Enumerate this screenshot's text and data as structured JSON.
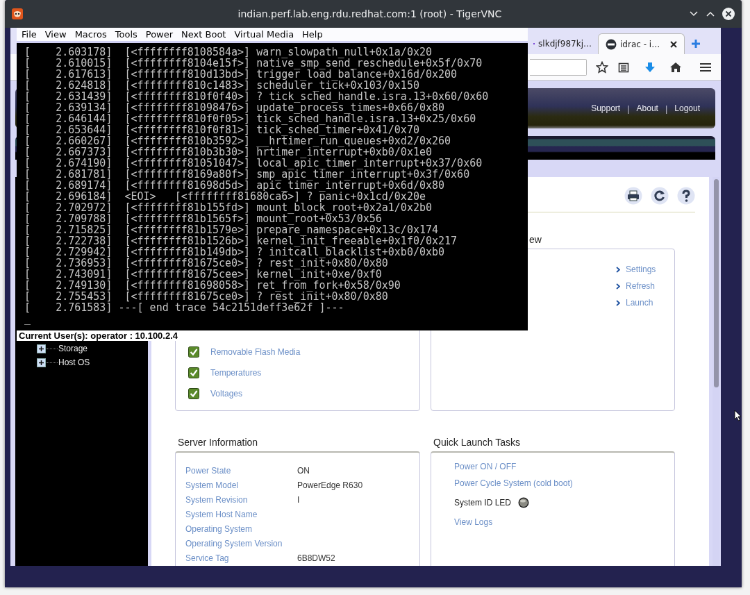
{
  "vnc_window": {
    "title": "indian.perf.lab.eng.rdu.redhat.com:1 (root) - TigerVNC"
  },
  "browser": {
    "tabs": [
      {
        "label": "slkdjf987kj…",
        "selected": false
      },
      {
        "label": "idrac - i…",
        "selected": true
      }
    ]
  },
  "page": {
    "header_items": [
      {
        "kind": "link",
        "label": "Support"
      },
      {
        "kind": "separator",
        "label": "|"
      },
      {
        "kind": "link",
        "label": "About"
      },
      {
        "kind": "separator",
        "label": "|"
      },
      {
        "kind": "link",
        "label": "Logout"
      }
    ],
    "tree": [
      {
        "label": "Storage",
        "expanded": false
      },
      {
        "label": "Host OS",
        "expanded": false
      }
    ],
    "overview": {
      "title": "ew",
      "links": [
        "Settings",
        "Refresh",
        "Launch"
      ]
    },
    "health_items": [
      {
        "label": "Removable Flash Media",
        "checked": true
      },
      {
        "label": "Temperatures",
        "checked": true
      },
      {
        "label": "Voltages",
        "checked": true
      }
    ],
    "server_information": {
      "title": "Server Information",
      "rows": [
        {
          "label": "Power State",
          "value": "ON"
        },
        {
          "label": "System Model",
          "value": "PowerEdge R630"
        },
        {
          "label": "System Revision",
          "value": "I"
        },
        {
          "label": "System Host Name"
        },
        {
          "label": "Operating System"
        },
        {
          "label": "Operating System Version"
        },
        {
          "label": "Service Tag",
          "value": "6B8DW52"
        }
      ]
    },
    "quick_launch": {
      "title": "Quick Launch Tasks",
      "items": [
        {
          "kind": "link",
          "label": "Power ON / OFF"
        },
        {
          "kind": "link",
          "label": "Power Cycle System (cold boot)"
        },
        {
          "kind": "led",
          "label": "System ID LED",
          "on": false
        },
        {
          "kind": "link",
          "label": "View Logs"
        }
      ]
    }
  },
  "console": {
    "menu": [
      "File",
      "View",
      "Macros",
      "Tools",
      "Power",
      "Next Boot",
      "Virtual Media",
      "Help"
    ],
    "lines": [
      "[    2.603178]  [<ffffffff8108584a>] warn_slowpath_null+0x1a/0x20",
      "[    2.610015]  [<ffffffff8104e15f>] native_smp_send_reschedule+0x5f/0x70",
      "[    2.617613]  [<ffffffff810d13bd>] trigger_load_balance+0x16d/0x200",
      "[    2.624818]  [<ffffffff810c1483>] scheduler_tick+0x103/0x150",
      "[    2.631439]  [<ffffffff810f0f40>] ? tick_sched_handle.isra.13+0x60/0x60",
      "[    2.639134]  [<ffffffff81098476>] update_process_times+0x66/0x80",
      "[    2.646144]  [<ffffffff810f0f05>] tick_sched_handle.isra.13+0x25/0x60",
      "[    2.653644]  [<ffffffff810f0f81>] tick_sched_timer+0x41/0x70",
      "[    2.660267]  [<ffffffff810b3592>] __hrtimer_run_queues+0xd2/0x260",
      "[    2.667373]  [<ffffffff810b3b30>] hrtimer_interrupt+0xb0/0x1e0",
      "[    2.674190]  [<ffffffff81051047>] local_apic_timer_interrupt+0x37/0x60",
      "[    2.681781]  [<ffffffff8169a80f>] smp_apic_timer_interrupt+0x3f/0x60",
      "[    2.689174]  [<ffffffff81698d5d>] apic_timer_interrupt+0x6d/0x80",
      "[    2.696184]  <EOI>   [<ffffffff81680ca6>] ? panic+0x1cd/0x20e",
      "[    2.702972]  [<ffffffff81b155fd>] mount_block_root+0x2a1/0x2b0",
      "[    2.709788]  [<ffffffff81b1565f>] mount_root+0x53/0x56",
      "[    2.715825]  [<ffffffff81b1579e>] prepare_namespace+0x13c/0x174",
      "[    2.722738]  [<ffffffff81b1526b>] kernel_init_freeable+0x1f0/0x217",
      "[    2.729942]  [<ffffffff81b149db>] ? initcall_blacklist+0xb0/0xb0",
      "[    2.736953]  [<ffffffff81675ce0>] ? rest_init+0x80/0x80",
      "[    2.743091]  [<ffffffff81675cee>] kernel_init+0xe/0xf0",
      "[    2.749130]  [<ffffffff81698058>] ret_from_fork+0x58/0x90",
      "[    2.755453]  [<ffffffff81675ce0>] ? rest_init+0x80/0x80",
      "[    2.761583] ---[ end trace 54c2151deff3e62f ]---"
    ],
    "cursor": "_",
    "current_users": "Current User(s): operator : 10.100.2.4"
  }
}
